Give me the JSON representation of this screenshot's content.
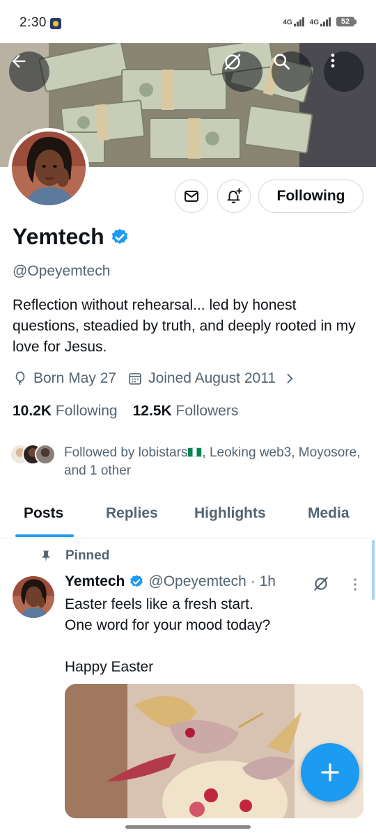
{
  "status_bar": {
    "time": "2:30",
    "network_1": "4G",
    "network_2": "4G",
    "battery": "52"
  },
  "header": {
    "back_icon": "arrow-left-icon",
    "grok_icon": "grok-slash-icon",
    "search_icon": "search-icon",
    "more_icon": "more-vertical-icon"
  },
  "profile": {
    "name": "Yemtech",
    "verified": true,
    "handle": "@Opeyemtech",
    "bio": "Reflection without rehearsal... led by honest questions, steadied by truth, and deeply rooted in my love for Jesus.",
    "birthday": "Born May 27",
    "joined": "Joined August 2011",
    "following_count": "10.2K",
    "following_label": "Following",
    "followers_count": "12.5K",
    "followers_label": "Followers",
    "followed_by_prefix": "Followed by lobistars",
    "followed_by_suffix": ", Leoking web3, Moyosore, and 1 other"
  },
  "actions": {
    "following_button": "Following",
    "message_icon": "envelope-icon",
    "notify_icon": "bell-plus-icon"
  },
  "tabs": [
    {
      "label": "Posts",
      "active": true
    },
    {
      "label": "Replies",
      "active": false
    },
    {
      "label": "Highlights",
      "active": false
    },
    {
      "label": "Media",
      "active": false
    }
  ],
  "pinned_post": {
    "pinned_label": "Pinned",
    "author_name": "Yemtech",
    "author_handle": "@Opeyemtech",
    "time": "· 1h",
    "text": "Easter feels like a fresh start.\nOne word for your mood today?\n\nHappy Easter"
  },
  "colors": {
    "accent": "#1d9bf0",
    "secondary_text": "#536471",
    "primary_text": "#0f1419",
    "border": "#cfd9de"
  }
}
